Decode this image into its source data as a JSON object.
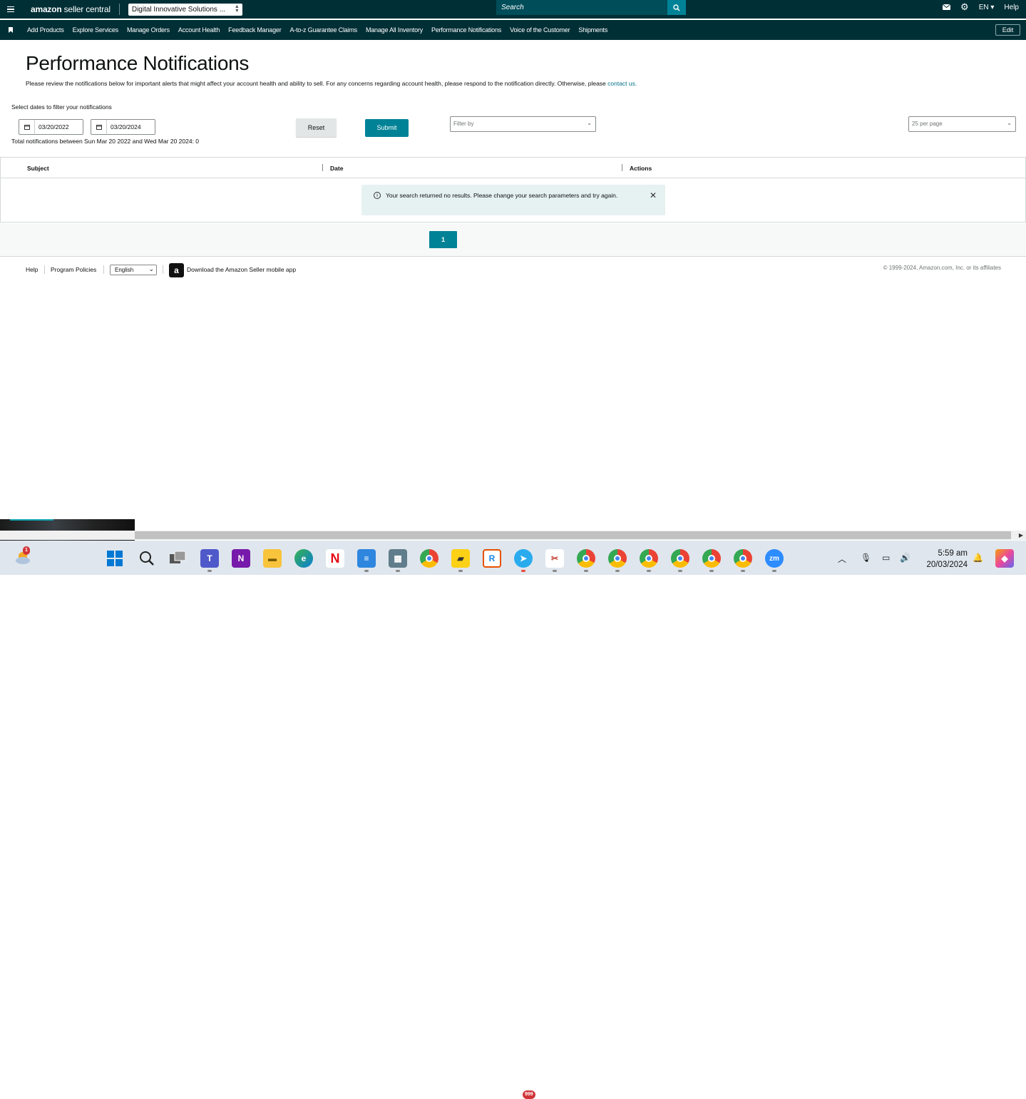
{
  "header": {
    "logo_brand": "amazon",
    "logo_suffix": "seller central",
    "account": "Digital Innovative Solutions ...",
    "search_placeholder": "Search",
    "language": "EN",
    "help": "Help"
  },
  "nav": {
    "items": [
      "Add Products",
      "Explore Services",
      "Manage Orders",
      "Account Health",
      "Feedback Manager",
      "A-to-z Guarantee Claims",
      "Manage All Inventory",
      "Performance Notifications",
      "Voice of the Customer",
      "Shipments"
    ],
    "edit": "Edit"
  },
  "page": {
    "title": "Performance Notifications",
    "description": "Please review the notifications below for important alerts that might affect your account health and ability to sell. For any concerns regarding account health, please respond to the notification directly. Otherwise, please ",
    "contact_link": "contact us.",
    "date_label": "Select dates to filter your notifications",
    "date_from": "03/20/2022",
    "date_to": "03/20/2024",
    "total": "Total notifications between Sun Mar 20 2022 and Wed Mar 20 2024: 0",
    "reset": "Reset",
    "submit": "Submit",
    "filter_placeholder": "Filter by",
    "per_page": "25 per page"
  },
  "table": {
    "columns": [
      "Subject",
      "Date",
      "Actions"
    ],
    "empty_message": "Your search returned no results. Please change your search parameters and try again."
  },
  "pagination": {
    "current": "1"
  },
  "footer": {
    "help": "Help",
    "policies": "Program Policies",
    "language": "English",
    "app_text": "Download the Amazon Seller mobile app",
    "copyright": "© 1999-2024, Amazon.com, Inc. or its affiliates"
  },
  "taskbar": {
    "weather_badge": "1",
    "telegram_badge": "999",
    "time": "5:59 am",
    "date": "20/03/2024"
  },
  "colors": {
    "header_bg": "#002f36",
    "accent": "#008296"
  }
}
